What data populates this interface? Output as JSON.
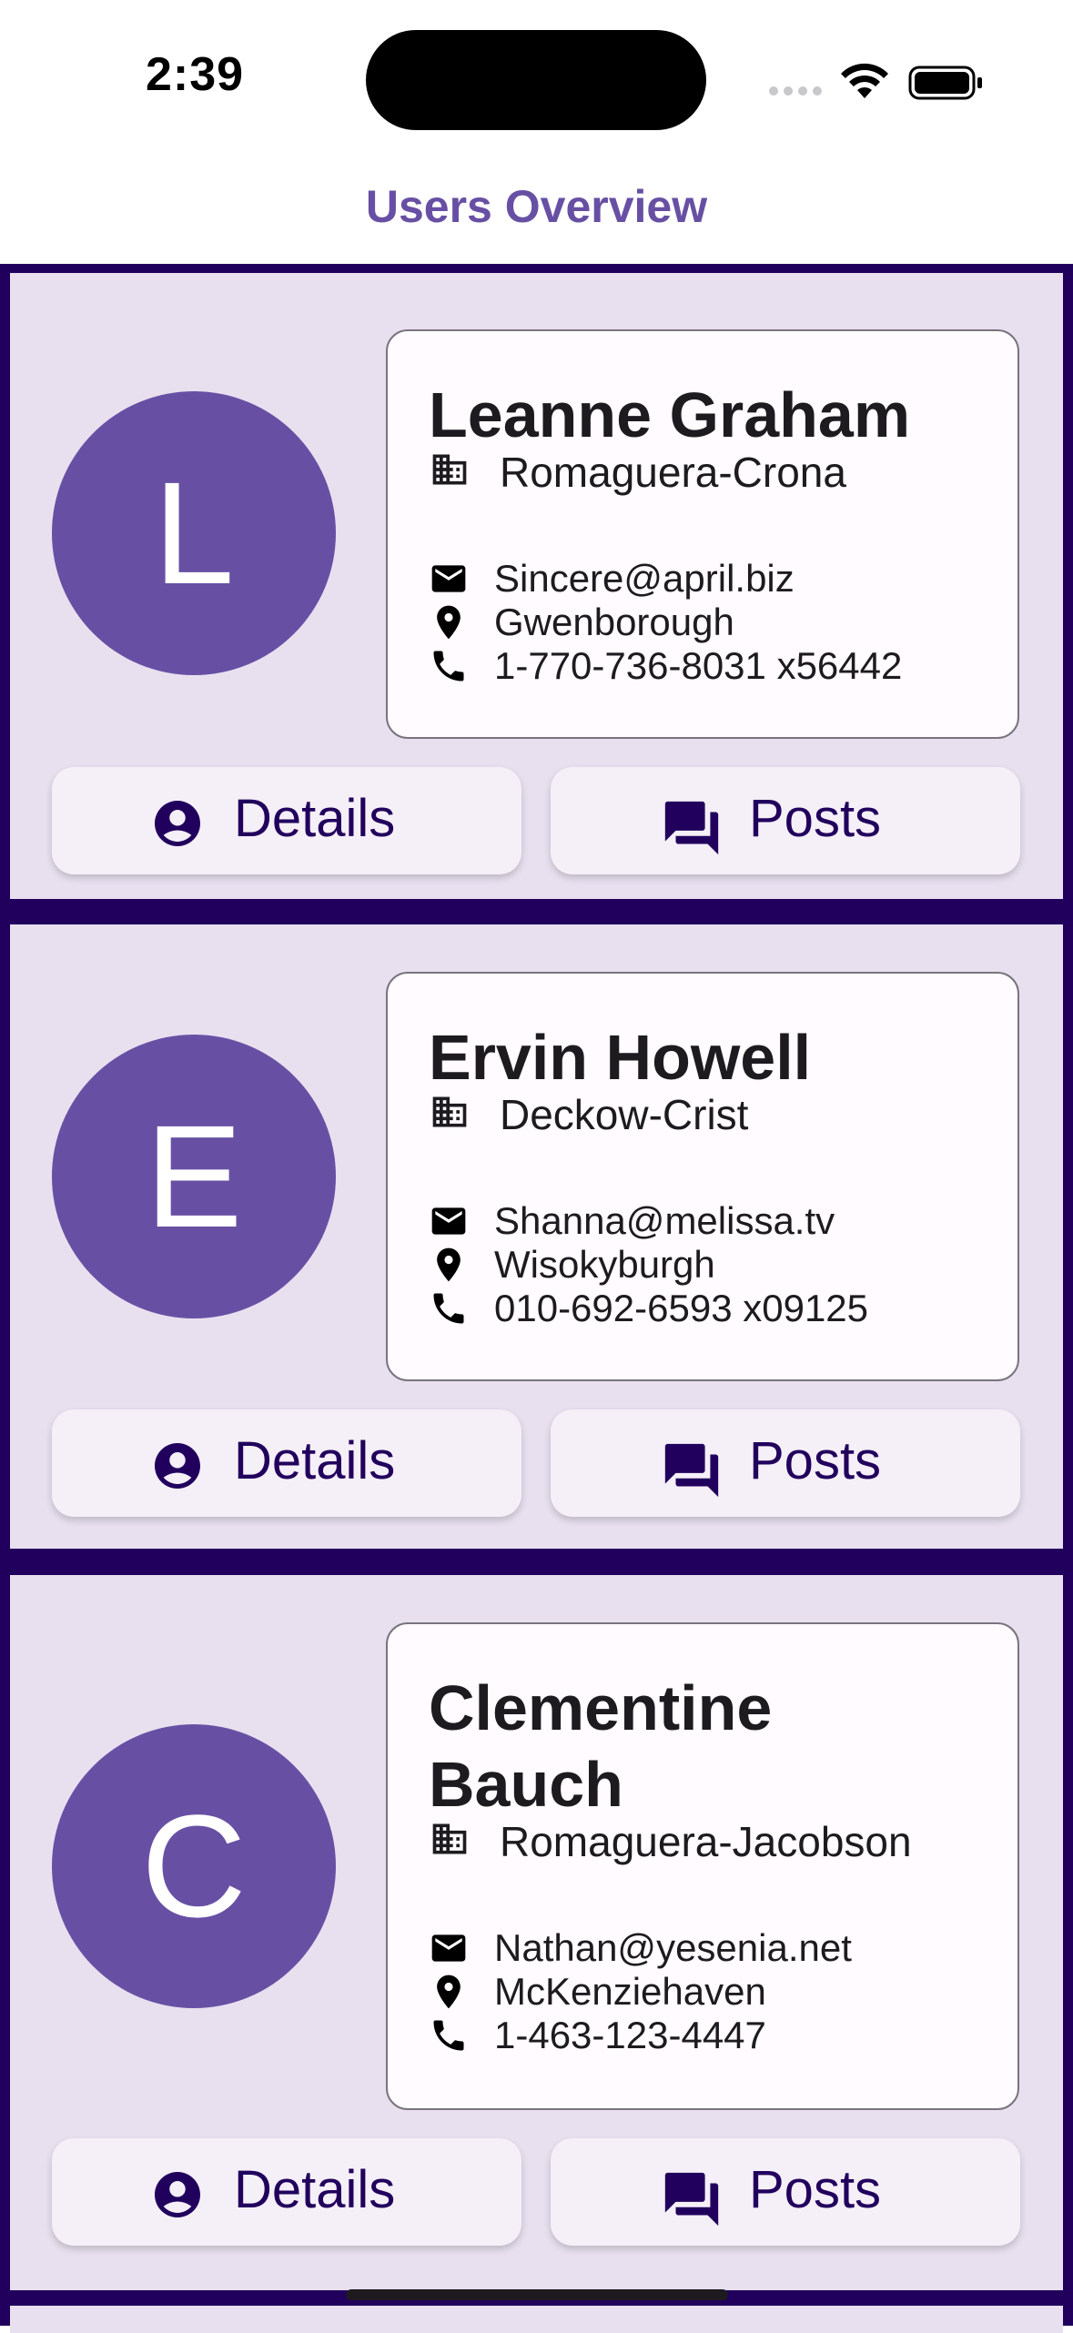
{
  "status_bar": {
    "time": "2:39"
  },
  "header": {
    "title": "Users Overview"
  },
  "users": [
    {
      "initial": "L",
      "name": "Leanne Graham",
      "company": "Romaguera-Crona",
      "email": "Sincere@april.biz",
      "city": "Gwenborough",
      "phone": "1-770-736-8031 x56442",
      "details_label": "Details",
      "posts_label": "Posts"
    },
    {
      "initial": "E",
      "name": "Ervin Howell",
      "company": "Deckow-Crist",
      "email": "Shanna@melissa.tv",
      "city": "Wisokyburgh",
      "phone": "010-692-6593 x09125",
      "details_label": "Details",
      "posts_label": "Posts"
    },
    {
      "initial": "C",
      "name": "Clementine Bauch",
      "company": "Romaguera-Jacobson",
      "email": "Nathan@yesenia.net",
      "city": "McKenziehaven",
      "phone": "1-463-123-4447",
      "details_label": "Details",
      "posts_label": "Posts"
    }
  ],
  "colors": {
    "accent": "#6750a4",
    "list_background": "#21005d",
    "card_background": "#e8e0ef"
  }
}
